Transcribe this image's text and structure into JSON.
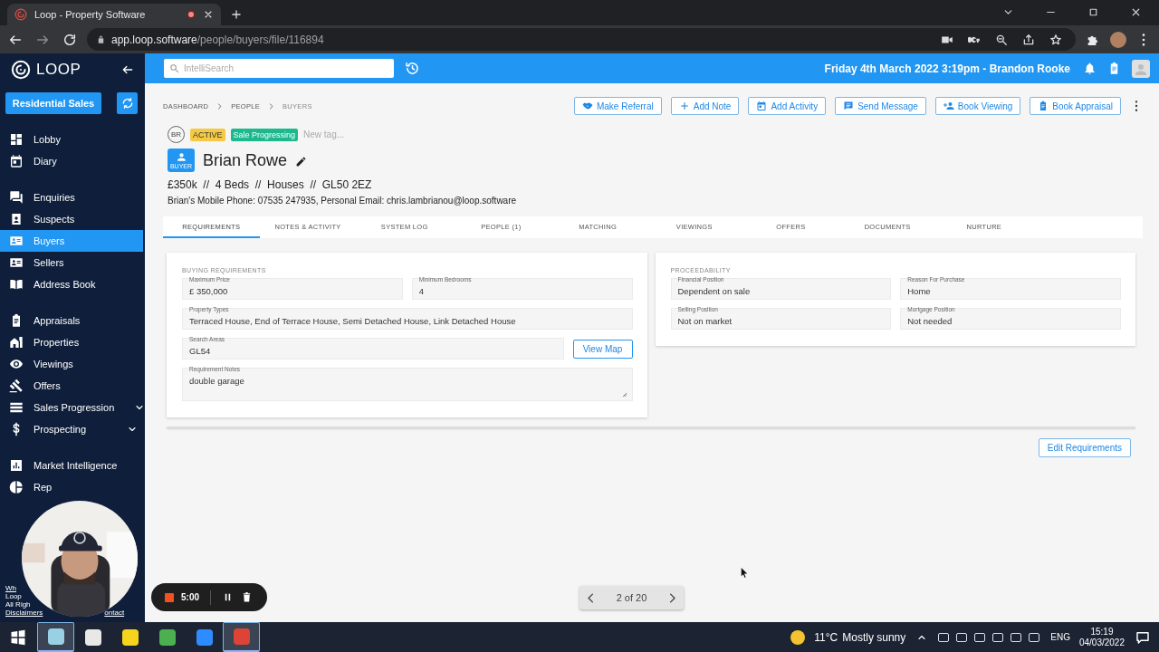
{
  "browser": {
    "tab_title": "Loop - Property Software",
    "url_host": "app.loop.software",
    "url_path": "/people/buyers/file/116894"
  },
  "app_bar": {
    "logo": "LOOP",
    "search_placeholder": "IntelliSearch",
    "status": "Friday 4th March 2022 3:19pm - Brandon Rooke"
  },
  "sidebar": {
    "team_button": "Residential Sales",
    "sections": [
      [
        {
          "label": "Lobby",
          "selected": false,
          "has_submenu": false
        },
        {
          "label": "Diary",
          "selected": false,
          "has_submenu": false
        }
      ],
      [
        {
          "label": "Enquiries",
          "selected": false,
          "has_submenu": false
        },
        {
          "label": "Suspects",
          "selected": false,
          "has_submenu": false
        },
        {
          "label": "Buyers",
          "selected": true,
          "has_submenu": false
        },
        {
          "label": "Sellers",
          "selected": false,
          "has_submenu": false
        },
        {
          "label": "Address Book",
          "selected": false,
          "has_submenu": false
        }
      ],
      [
        {
          "label": "Appraisals",
          "selected": false,
          "has_submenu": false
        },
        {
          "label": "Properties",
          "selected": false,
          "has_submenu": false
        },
        {
          "label": "Viewings",
          "selected": false,
          "has_submenu": false
        },
        {
          "label": "Offers",
          "selected": false,
          "has_submenu": false
        },
        {
          "label": "Sales Progression",
          "selected": false,
          "has_submenu": true
        },
        {
          "label": "Prospecting",
          "selected": false,
          "has_submenu": true
        }
      ],
      [
        {
          "label": "Market Intelligence",
          "selected": false,
          "has_submenu": false
        },
        {
          "label": "Rep",
          "selected": false,
          "has_submenu": false
        }
      ]
    ],
    "footer_lines": [
      "Wh",
      "Loop",
      "All Righ"
    ],
    "footer_links": [
      "Disclaimers",
      "ontact"
    ]
  },
  "breadcrumbs": [
    "DASHBOARD",
    "PEOPLE",
    "BUYERS"
  ],
  "actions": [
    {
      "label": "Make Referral"
    },
    {
      "label": "Add Note"
    },
    {
      "label": "Add Activity"
    },
    {
      "label": "Send Message"
    },
    {
      "label": "Book Viewing"
    },
    {
      "label": "Book Appraisal"
    }
  ],
  "record": {
    "initials": "BR",
    "tags": [
      {
        "label": "ACTIVE",
        "color": "#f6c945"
      },
      {
        "label": "Sale Progressing",
        "color": "#1db88e"
      }
    ],
    "new_tag_placeholder": "New tag...",
    "role": "BUYER",
    "name": "Brian Rowe",
    "summary": "£350k  //  4 Beds  //  Houses  //  GL50 2EZ",
    "contact": "Brian's Mobile Phone: 07535 247935, Personal Email: chris.lambrianou@loop.software"
  },
  "tabs": [
    {
      "label": "REQUIREMENTS",
      "selected": true
    },
    {
      "label": "NOTES & ACTIVITY",
      "selected": false
    },
    {
      "label": "SYSTEM LOG",
      "selected": false
    },
    {
      "label": "PEOPLE (1)",
      "selected": false
    },
    {
      "label": "MATCHING",
      "selected": false
    },
    {
      "label": "VIEWINGS",
      "selected": false
    },
    {
      "label": "OFFERS",
      "selected": false
    },
    {
      "label": "DOCUMENTS",
      "selected": false
    },
    {
      "label": "NURTURE",
      "selected": false
    }
  ],
  "cards": [
    {
      "title": "BUYING REQUIREMENTS",
      "rows": [
        [
          {
            "label": "Maximum Price",
            "value": "£ 350,000",
            "kind": "text"
          },
          {
            "label": "Minimum Bedrooms",
            "value": "4",
            "kind": "text"
          }
        ],
        [
          {
            "label": "Property Types",
            "value": "Terraced House, End of Terrace House, Semi Detached House, Link Detached House",
            "kind": "text"
          }
        ],
        [
          {
            "label": "Search Areas",
            "value": "GL54",
            "kind": "text",
            "button": "View Map"
          }
        ],
        [
          {
            "label": "Requirement Notes",
            "value": "double garage",
            "kind": "textarea"
          }
        ]
      ]
    },
    {
      "title": "PROCEEDABILITY",
      "rows": [
        [
          {
            "label": "Financial Position",
            "value": "Dependent on sale",
            "kind": "text"
          },
          {
            "label": "Reason For Purchase",
            "value": "Home",
            "kind": "text"
          }
        ],
        [
          {
            "label": "Selling Position",
            "value": "Not on market",
            "kind": "text"
          },
          {
            "label": "Mortgage Position",
            "value": "Not needed",
            "kind": "text"
          }
        ]
      ]
    }
  ],
  "edit_button": "Edit Requirements",
  "pager": {
    "label": "2 of 20"
  },
  "recorder": {
    "time": "5:00"
  },
  "webcam": {
    "kind": "picture"
  },
  "taskbar": {
    "temperature": "11°C",
    "weather": "Mostly sunny",
    "language": "ENG",
    "time": "15:19",
    "date": "04/03/2022"
  }
}
